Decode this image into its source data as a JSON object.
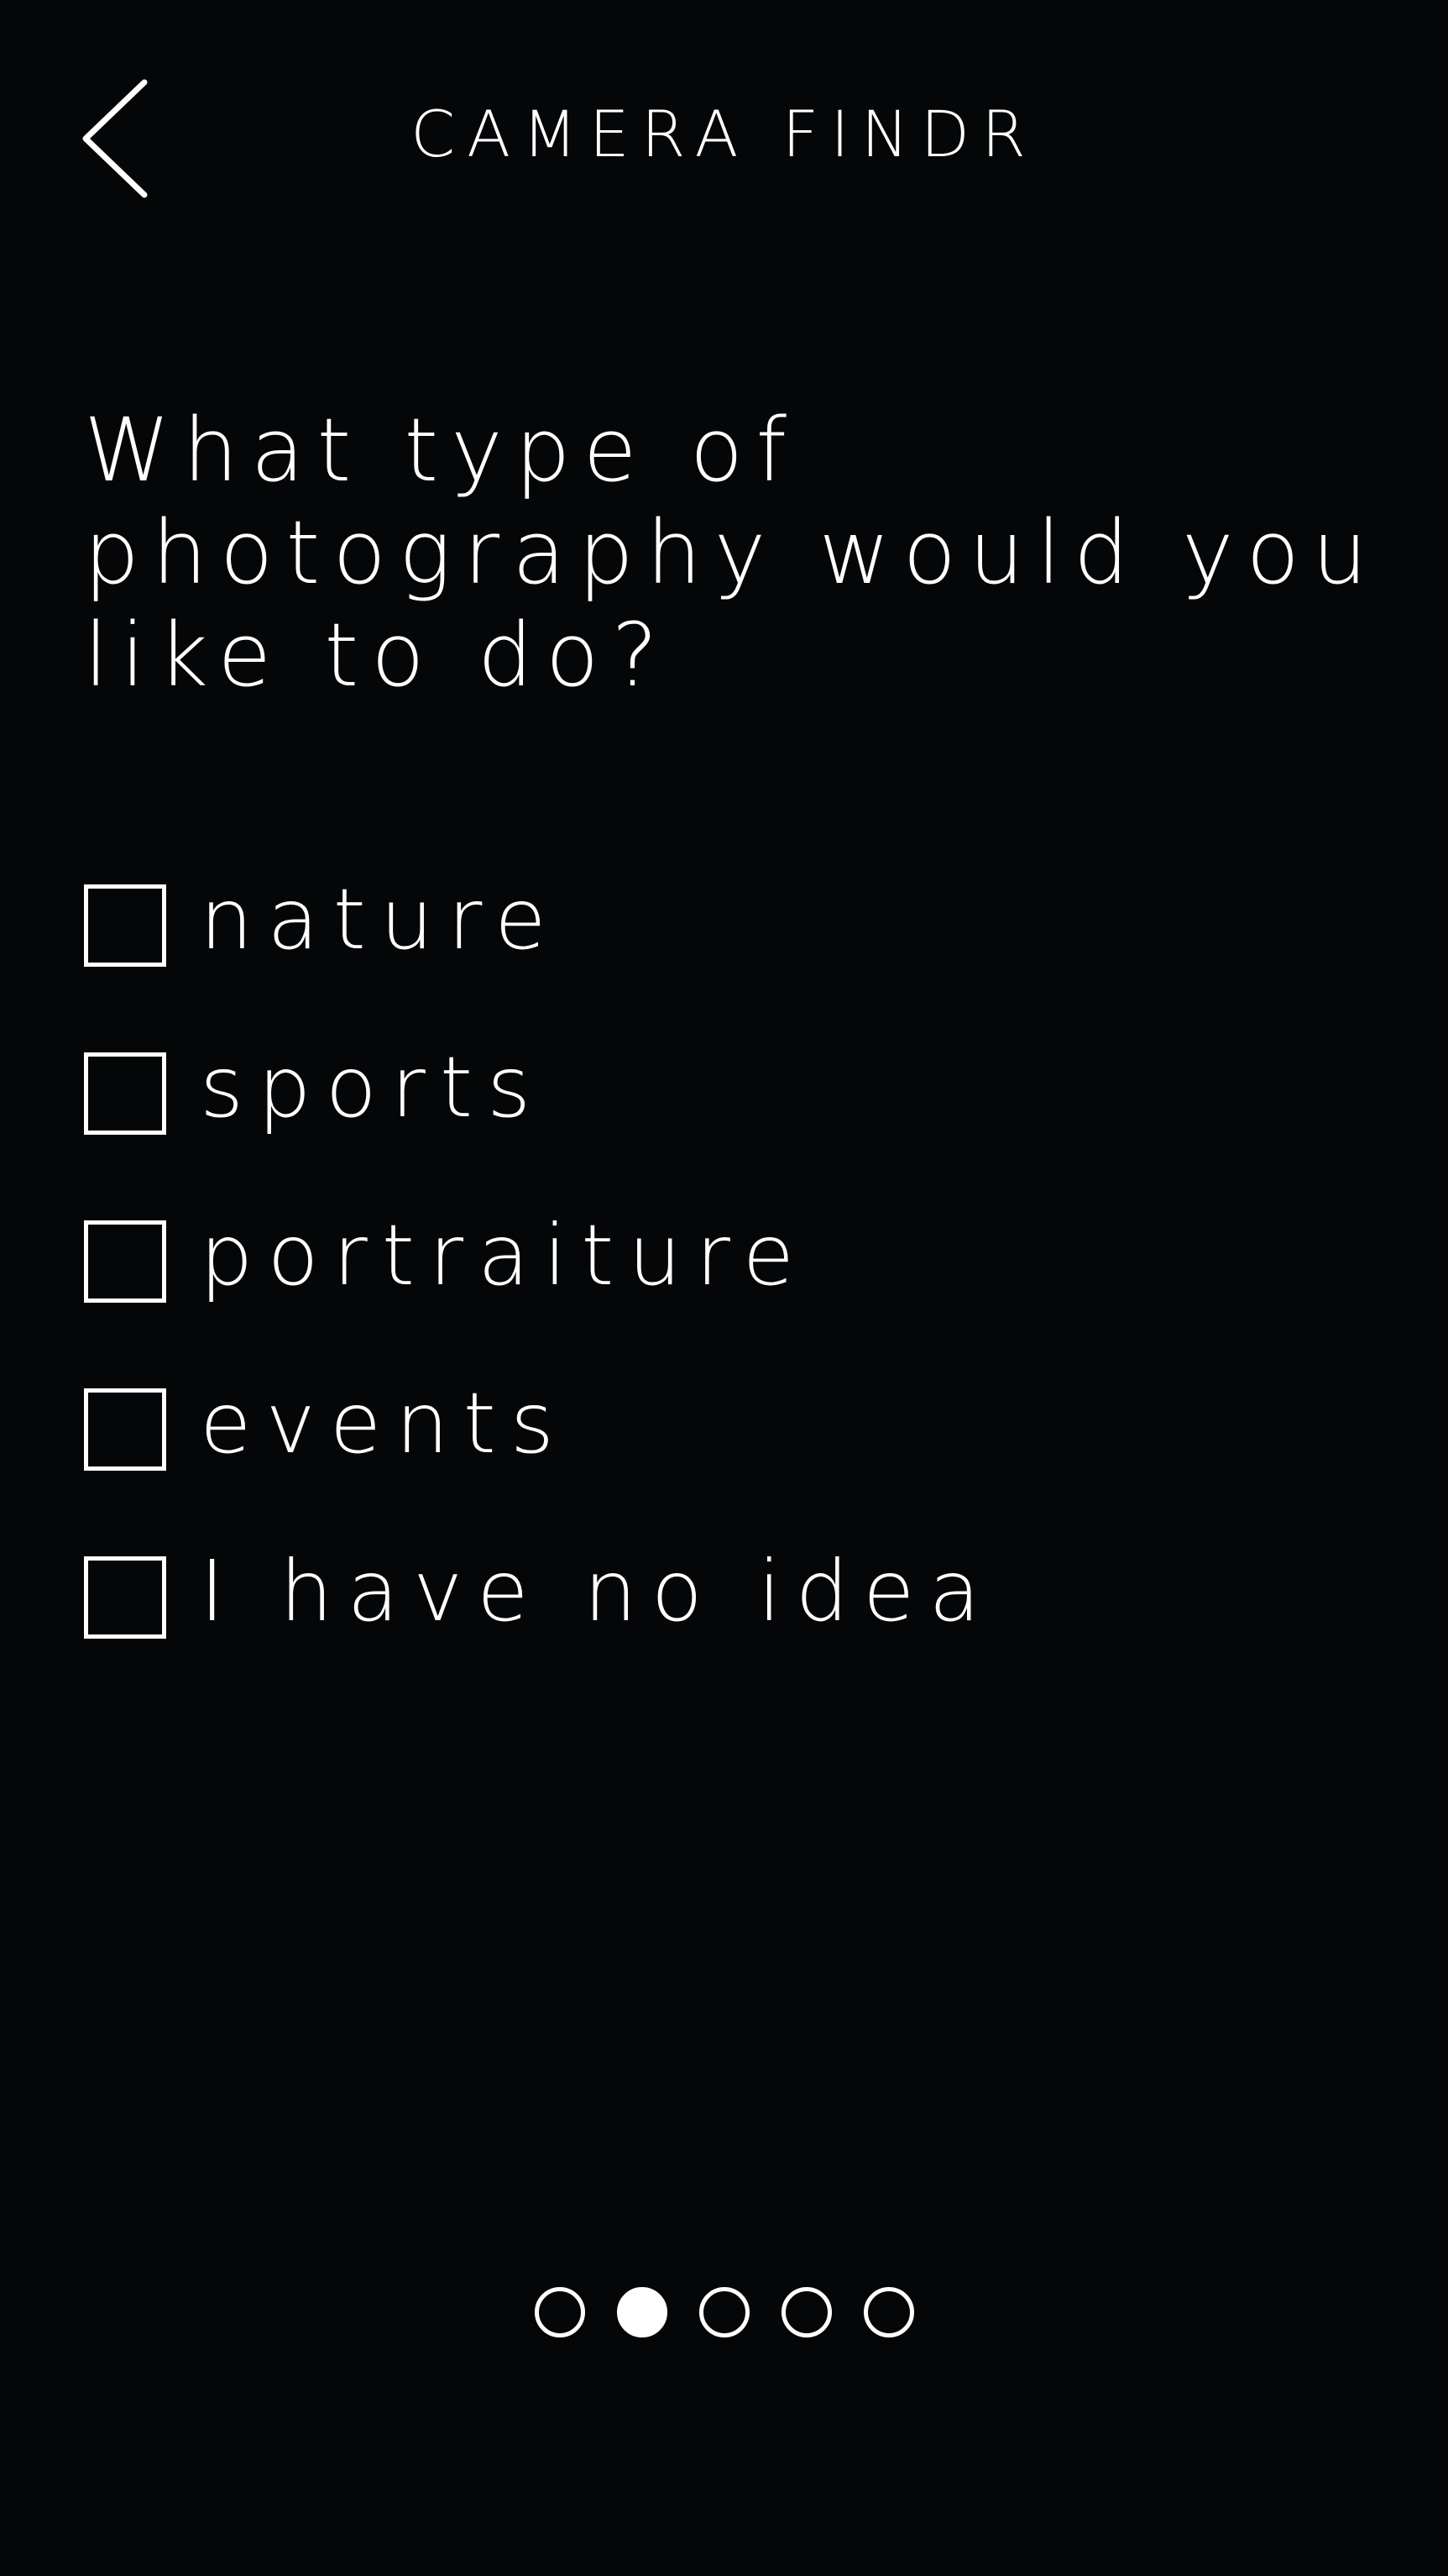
{
  "header": {
    "title": "CAMERA FINDR",
    "back_icon": "chevron-left-icon"
  },
  "question": "What type of photography would you like to do?",
  "options": [
    {
      "label": "nature",
      "checked": false
    },
    {
      "label": "sports",
      "checked": false
    },
    {
      "label": "portraiture",
      "checked": false
    },
    {
      "label": "events",
      "checked": false
    },
    {
      "label": "I have no idea",
      "checked": false
    }
  ],
  "pager": {
    "total": 5,
    "current": 2
  },
  "colors": {
    "background": "#040608",
    "foreground": "#ffffff"
  }
}
